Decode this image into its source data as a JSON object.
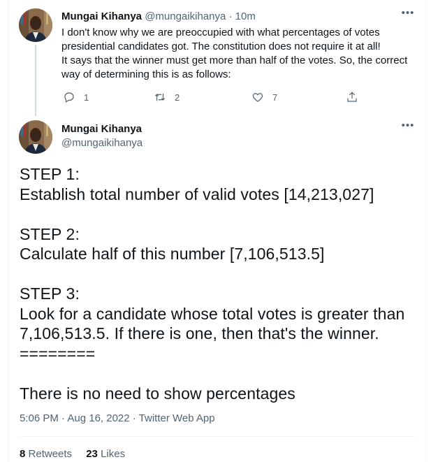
{
  "reply_tweet": {
    "author_name": "Mungai Kihanya",
    "author_handle": "@mungaikihanya",
    "time_ago": "10m",
    "text_lines": [
      "I don't know why we are preoccupied with what percentages of votes",
      "presidential candidates got. The constitution does not require it at all!",
      "It says that the winner must get more than half of the votes. So, the correct",
      "way of determining this is as follows:"
    ],
    "reply_count": "1",
    "retweet_count": "2",
    "like_count": "7",
    "icons": [
      "reply-icon",
      "retweet-icon",
      "like-icon",
      "share-icon",
      "more-icon"
    ]
  },
  "main_tweet": {
    "author_name": "Mungai Kihanya",
    "author_handle": "@mungaikihanya",
    "body_lines": [
      "STEP 1:",
      "Establish total number of valid votes [14,213,027]",
      "",
      "STEP 2:",
      "Calculate half of this number [7,106,513.5]",
      "",
      "STEP 3:",
      "Look for a candidate whose total votes is greater than",
      "7,106,513.5. If there is one, then that's the winner.",
      "========",
      "",
      "There is no need to show percentages"
    ],
    "timestamp": "5:06 PM · Aug 16, 2022 · ",
    "source": "Twitter Web App",
    "retweets_count": "8",
    "retweets_label": "Retweets",
    "likes_count": "23",
    "likes_label": "Likes"
  },
  "colors": {
    "text": "#0f1419",
    "muted": "#536471",
    "border": "#eff3f4",
    "thread_line": "#cfd9de"
  }
}
